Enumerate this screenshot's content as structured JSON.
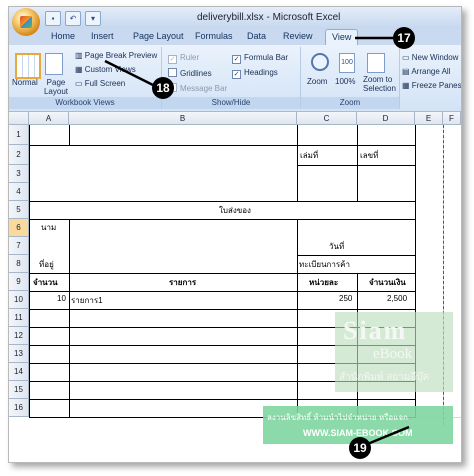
{
  "window": {
    "title": "deliverybill.xlsx - Microsoft Excel"
  },
  "quick_access": [
    "save",
    "undo",
    "open"
  ],
  "tabs": [
    {
      "label": "Home"
    },
    {
      "label": "Insert"
    },
    {
      "label": "Page Layout"
    },
    {
      "label": "Formulas"
    },
    {
      "label": "Data"
    },
    {
      "label": "Review"
    },
    {
      "label": "View"
    }
  ],
  "ribbon": {
    "workbook_views": {
      "group_label": "Workbook Views",
      "normal": "Normal",
      "page_layout": "Page Layout",
      "page_break_preview": "Page Break Preview",
      "custom_views": "Custom Views",
      "full_screen": "Full Screen"
    },
    "show_hide": {
      "group_label": "Show/Hide",
      "ruler": "Ruler",
      "gridlines": "Gridlines",
      "message_bar": "Message Bar",
      "formula_bar": "Formula Bar",
      "headings": "Headings"
    },
    "zoom": {
      "group_label": "Zoom",
      "zoom": "Zoom",
      "hundred": "100%",
      "zoom_to_selection": "Zoom to Selection"
    },
    "window": {
      "new_window": "New Window",
      "arrange_all": "Arrange All",
      "freeze_panes": "Freeze Panes"
    }
  },
  "callouts": {
    "c17": "17",
    "c18": "18",
    "c19": "19"
  },
  "sheet": {
    "columns": [
      "A",
      "B",
      "C",
      "D",
      "E",
      "F"
    ],
    "rows": [
      "1",
      "2",
      "3",
      "4",
      "5",
      "6",
      "7",
      "8",
      "9",
      "10",
      "11",
      "12",
      "13",
      "14",
      "15",
      "16"
    ],
    "cells": {
      "c2": "เล่มที่",
      "d2": "เลขที่",
      "b5": "ใบส่งของ",
      "a6": "นาม",
      "c7": "วันที่",
      "a8": "ที่อยู่",
      "c8": "ทะเบียนการค้า",
      "a9": "จำนวน",
      "b9": "รายการ",
      "c9": "หน่วยละ",
      "d9": "จำนวนเงิน",
      "a10": "10",
      "b10": "รายการ1",
      "c10": "250",
      "d10": "2,500"
    }
  },
  "watermark": {
    "title": "Siam",
    "subtitle": "eBook",
    "thai": "สำนักพิมพ์ สยามอีบุ๊ค"
  },
  "banner": {
    "line1": "ลงานลิขสิทธิ์ ห้ามนำไปจำหน่าย หรือแจก",
    "line2": "WWW.SIAM-EBOOK.COM"
  },
  "colors": {
    "ribbon_bg": "#d3e3f6",
    "selected_row_header": "#f9d99c",
    "callout": "#000000",
    "banner": "#80d6a0"
  }
}
